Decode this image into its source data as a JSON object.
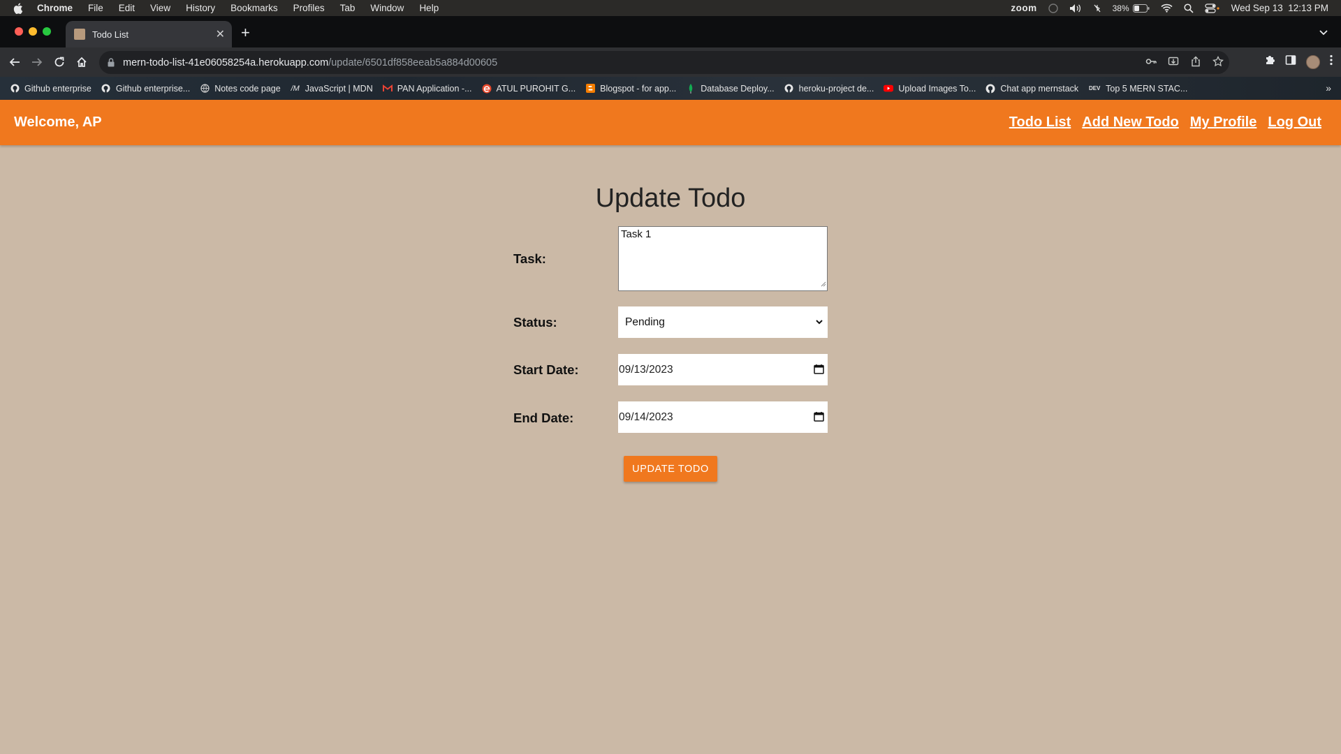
{
  "os_menubar": {
    "items": [
      "Chrome",
      "File",
      "Edit",
      "View",
      "History",
      "Bookmarks",
      "Profiles",
      "Tab",
      "Window",
      "Help"
    ],
    "zoom_label": "zoom",
    "battery": "38%",
    "datetime": "Wed Sep 13  12:13 PM"
  },
  "browser": {
    "tab_title": "Todo List",
    "url_host": "mern-todo-list-41e06058254a.herokuapp.com",
    "url_path": "/update/6501df858eeab5a884d00605",
    "bookmarks": [
      {
        "label": "Github enterprise",
        "icon": "github-icon"
      },
      {
        "label": "Github enterprise...",
        "icon": "github-icon"
      },
      {
        "label": "Notes code page",
        "icon": "globe-icon"
      },
      {
        "label": "JavaScript | MDN",
        "icon": "mdn-icon"
      },
      {
        "label": "PAN Application -...",
        "icon": "gmail-icon"
      },
      {
        "label": "ATUL PUROHIT G...",
        "icon": "edge-icon"
      },
      {
        "label": "Blogspot - for app...",
        "icon": "blogger-icon"
      },
      {
        "label": "Database Deploy...",
        "icon": "mongodb-leaf-icon"
      },
      {
        "label": "heroku-project de...",
        "icon": "github-icon"
      },
      {
        "label": "Upload Images To...",
        "icon": "youtube-icon"
      },
      {
        "label": "Chat app mernstack",
        "icon": "github-icon"
      },
      {
        "label": "Top 5 MERN STAC...",
        "icon": "dev-icon"
      }
    ]
  },
  "app": {
    "welcome": "Welcome, AP",
    "nav": [
      "Todo List",
      "Add New Todo",
      "My Profile",
      "Log Out"
    ],
    "form": {
      "title": "Update Todo",
      "task_label": "Task:",
      "task_value": "Task 1",
      "status_label": "Status:",
      "status_value": "Pending",
      "start_label": "Start Date:",
      "start_value": "09/13/2023",
      "end_label": "End Date:",
      "end_value": "09/14/2023",
      "submit_label": "UPDATE TODO"
    }
  },
  "colors": {
    "navbar": "#f0781e",
    "page_background": "#cbb9a6",
    "button": "#f0781e"
  }
}
